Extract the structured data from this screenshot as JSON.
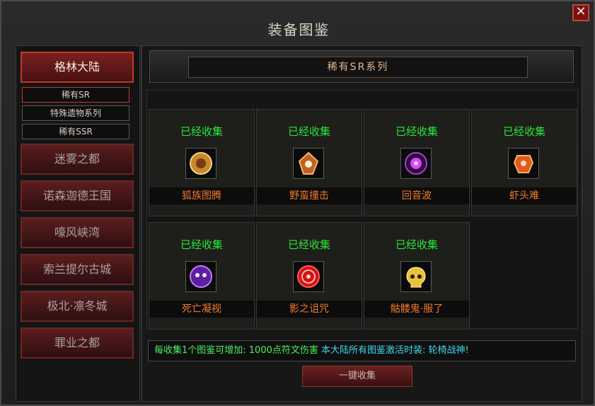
{
  "window": {
    "title": "装备图鉴",
    "close_label": "✕"
  },
  "sidebar": {
    "active_region": "格林大陆",
    "subitems": [
      "稀有SR",
      "特殊遗物系列",
      "稀有SSR"
    ],
    "regions": [
      "迷雾之都",
      "诺森迦德王国",
      "嚎风峡湾",
      "索兰提尔古城",
      "极北·凛冬城",
      "罪业之都"
    ]
  },
  "main": {
    "series_title": "稀有SR系列",
    "cards": [
      {
        "status": "已经收集",
        "name": "狐族图腾",
        "icon": "fox-totem-icon"
      },
      {
        "status": "已经收集",
        "name": "野蛮撞击",
        "icon": "savage-strike-icon"
      },
      {
        "status": "已经收集",
        "name": "回音波",
        "icon": "echo-wave-icon"
      },
      {
        "status": "已经收集",
        "name": "虾头难",
        "icon": "shrimp-head-icon"
      },
      {
        "status": "已经收集",
        "name": "死亡凝视",
        "icon": "death-gaze-icon"
      },
      {
        "status": "已经收集",
        "name": "影之诅咒",
        "icon": "shadow-curse-icon"
      },
      {
        "status": "已经收集",
        "name": "骷髅鬼·服了",
        "icon": "skull-ghost-icon"
      }
    ],
    "info_text_1": "每收集1个图鉴可增加: 1000点符文伤害",
    "info_text_2": "本大陆所有图鉴激活时装: 轮椅战神!",
    "collect_button": "一键收集"
  },
  "colors": {
    "collected_green": "#28e43a",
    "item_name_orange": "#f07a2a",
    "active_red": "#c0392b",
    "info_cyan": "#40d8e8"
  }
}
